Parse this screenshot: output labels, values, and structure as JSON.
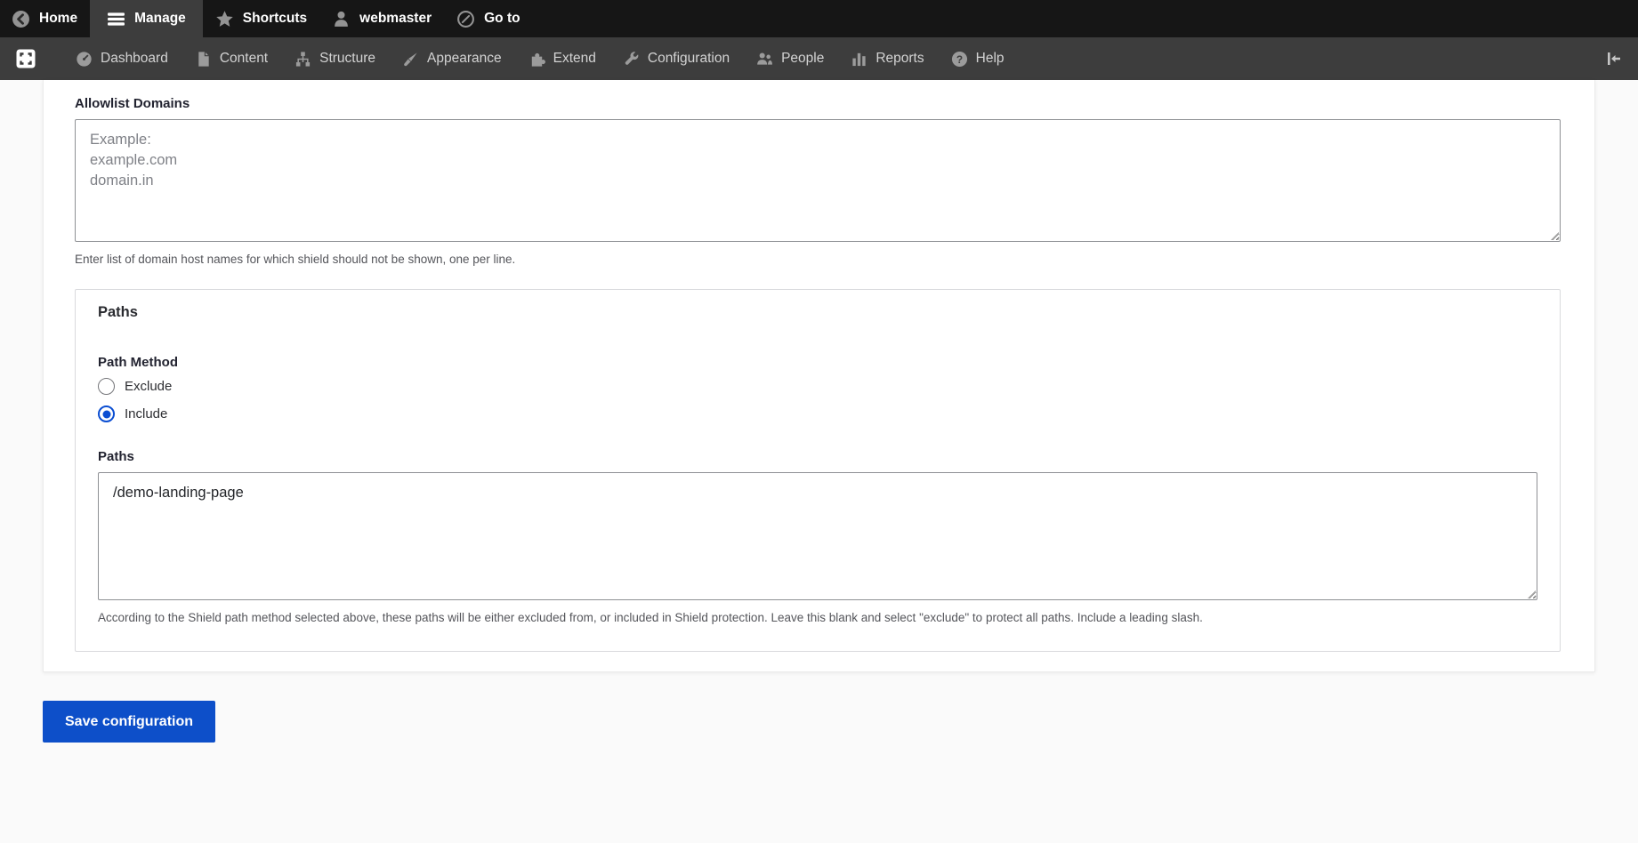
{
  "topbar": {
    "items": [
      {
        "label": "Home",
        "icon": "back-circle-icon"
      },
      {
        "label": "Manage",
        "icon": "hamburger-icon",
        "active": true
      },
      {
        "label": "Shortcuts",
        "icon": "star-icon"
      },
      {
        "label": "webmaster",
        "icon": "user-icon"
      },
      {
        "label": "Go to",
        "icon": "goto-search-icon"
      }
    ]
  },
  "admin_menu": {
    "items": [
      {
        "label": "Dashboard",
        "icon": "gauge-icon"
      },
      {
        "label": "Content",
        "icon": "document-icon"
      },
      {
        "label": "Structure",
        "icon": "sitemap-icon"
      },
      {
        "label": "Appearance",
        "icon": "paintbrush-icon"
      },
      {
        "label": "Extend",
        "icon": "puzzle-icon"
      },
      {
        "label": "Configuration",
        "icon": "wrench-icon"
      },
      {
        "label": "People",
        "icon": "people-icon"
      },
      {
        "label": "Reports",
        "icon": "bar-chart-icon"
      },
      {
        "label": "Help",
        "icon": "question-icon"
      }
    ]
  },
  "form": {
    "allowlist": {
      "label": "Allowlist Domains",
      "placeholder": "Example:\nexample.com\ndomain.in",
      "description": "Enter list of domain host names for which shield should not be shown, one per line."
    },
    "paths_fieldset": {
      "legend": "Paths",
      "path_method": {
        "label": "Path Method",
        "options": [
          {
            "label": "Exclude",
            "checked": false
          },
          {
            "label": "Include",
            "checked": true
          }
        ]
      },
      "paths": {
        "label": "Paths",
        "value": "/demo-landing-page",
        "description": "According to the Shield path method selected above, these paths will be either excluded from, or included in Shield protection. Leave this blank and select \"exclude\" to protect all paths. Include a leading slash."
      }
    },
    "save_button": "Save configuration"
  },
  "colors": {
    "topbar_bg": "#161616",
    "tray_bg": "#3d3d3d",
    "primary_blue": "#0d4fc9",
    "radio_blue": "#0b4ed2"
  }
}
